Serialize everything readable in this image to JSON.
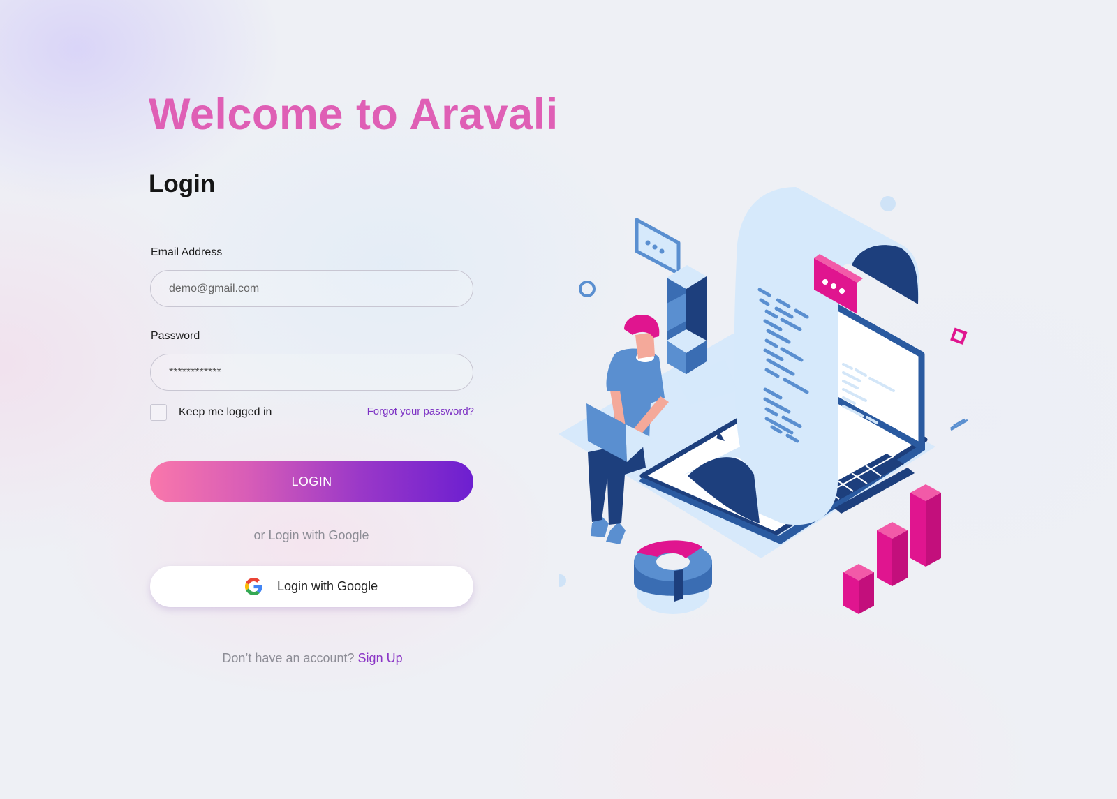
{
  "app": {
    "welcome_title": "Welcome to Aravali",
    "login_heading": "Login"
  },
  "form": {
    "email_label": "Email Address",
    "email_placeholder": "demo@gmail.com",
    "password_label": "Password",
    "password_value": "************",
    "keep_logged_in_label": "Keep me logged in",
    "keep_logged_in_checked": false,
    "forgot_password_link": "Forgot your password?",
    "login_button_label": "LOGIN",
    "divider_text": "or Login with Google",
    "google_button_label": "Login with Google",
    "signup_prompt": "Don’t have an account?",
    "signup_link": "Sign Up"
  },
  "icons": {
    "google": "google-g-logo",
    "illustration": "person-with-laptop-coding-isometric"
  },
  "colors": {
    "title_pink": "#df5fb5",
    "link_purple": "#7d32c4",
    "button_gradient_start": "#f977ab",
    "button_gradient_end": "#6d1fd0",
    "illustration_blue": "#5a8fd0",
    "illustration_navy": "#1d3f7d",
    "illustration_magenta": "#e0158f"
  }
}
